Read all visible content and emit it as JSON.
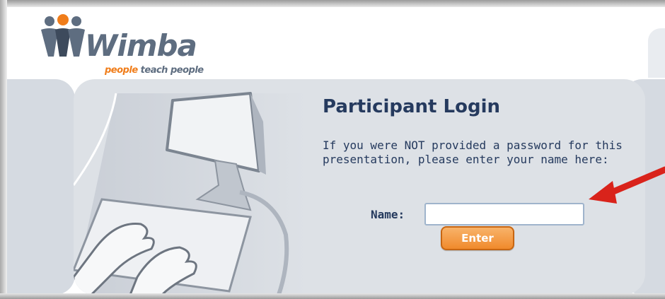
{
  "brand": {
    "name": "Wimba",
    "tagline_orange": "people",
    "tagline_gray": " teach people",
    "colors": {
      "orange": "#f07d1a",
      "slate": "#5e6d80",
      "navy": "#253a5e"
    }
  },
  "login": {
    "title": "Participant Login",
    "instructions": "If you were NOT provided a password for this presentation, please enter your name here:",
    "name_label": "Name:",
    "name_value": "",
    "enter_label": "Enter"
  },
  "icons": {
    "logo": "people-figures-icon",
    "illustration": "hands-on-keyboard-icon",
    "pointer": "red-arrow-icon"
  }
}
